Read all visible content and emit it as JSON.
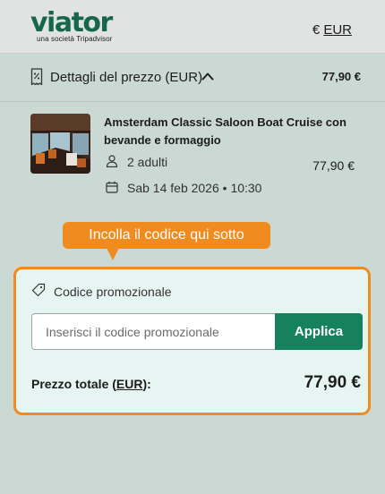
{
  "header": {
    "logo_word": "viator",
    "logo_sub": "una società Tripadvisor",
    "currency_symbol": "€",
    "currency_code": "EUR"
  },
  "price_details": {
    "title": "Dettagli del prezzo (EUR)",
    "total": "77,90 €"
  },
  "item": {
    "title": "Amsterdam Classic Saloon Boat Cruise con bevande e formaggio",
    "travelers": "2 adulti",
    "date": "Sab 14 feb 2026 • 10:30",
    "price": "77,90 €"
  },
  "tooltip": {
    "text": "Incolla il codice qui sotto"
  },
  "promo": {
    "label": "Codice promozionale",
    "placeholder": "Inserisci il codice promozionale",
    "value": "",
    "apply_label": "Applica"
  },
  "total": {
    "label_prefix": "Prezzo totale (",
    "label_code": "EUR",
    "label_suffix": "):",
    "value": "77,90 €"
  },
  "colors": {
    "brand": "#16664b",
    "accent_orange": "#f08c1f",
    "apply_button": "#16825d",
    "page_background": "#cad9d4",
    "promo_background": "#e6f5f1"
  }
}
